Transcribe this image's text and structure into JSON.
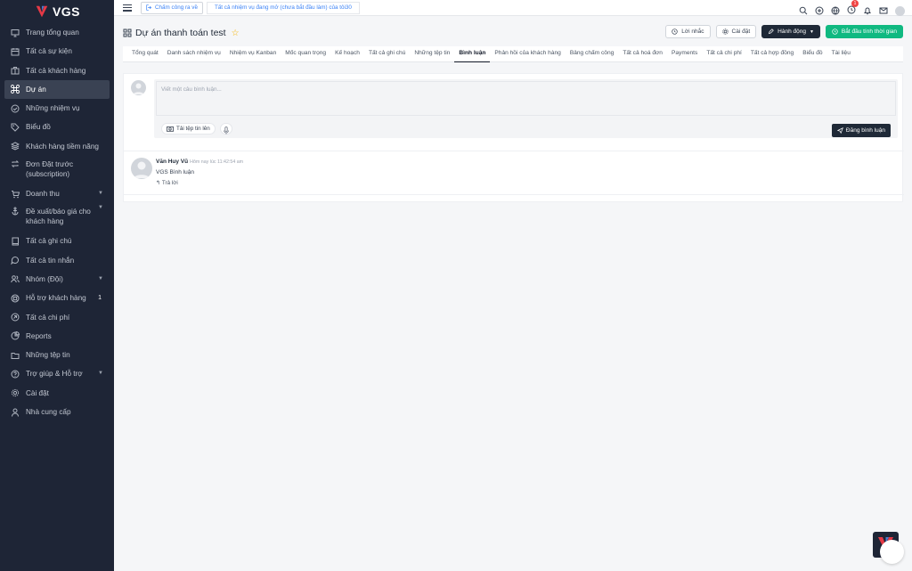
{
  "brand": {
    "name": "VGS",
    "accent": "#e63946"
  },
  "sidebar": {
    "items": [
      {
        "label": "Trang tổng quan",
        "icon": "monitor-icon"
      },
      {
        "label": "Tất cả sự kiện",
        "icon": "calendar-icon"
      },
      {
        "label": "Tất cả khách hàng",
        "icon": "briefcase-icon"
      },
      {
        "label": "Dự án",
        "icon": "command-icon",
        "active": true
      },
      {
        "label": "Những nhiệm vụ",
        "icon": "check-circle-icon"
      },
      {
        "label": "Biểu đồ",
        "icon": "tag-icon"
      },
      {
        "label": "Khách hàng tiềm năng",
        "icon": "layers-icon"
      },
      {
        "label": "Đơn Đặt trước (subscription)",
        "icon": "repeat-icon"
      },
      {
        "label": "Doanh thu",
        "icon": "cart-icon",
        "chevron": "▼"
      },
      {
        "label": "Đề xuất/báo giá cho khách hàng",
        "icon": "anchor-icon",
        "chevron": "▼"
      },
      {
        "label": "Tất cả ghi chú",
        "icon": "book-icon"
      },
      {
        "label": "Tất cả tin nhắn",
        "icon": "message-icon"
      },
      {
        "label": "Nhóm (Đội)",
        "icon": "users-icon",
        "chevron": "▼"
      },
      {
        "label": "Hỗ trợ khách hàng",
        "icon": "lifebuoy-icon",
        "count": "1"
      },
      {
        "label": "Tất cả chi phí",
        "icon": "arrow-circle-icon"
      },
      {
        "label": "Reports",
        "icon": "pie-chart-icon"
      },
      {
        "label": "Những tệp tin",
        "icon": "folder-icon"
      },
      {
        "label": "Trợ giúp & Hỗ trợ",
        "icon": "help-circle-icon",
        "chevron": "▼"
      },
      {
        "label": "Cài đặt",
        "icon": "settings-icon"
      },
      {
        "label": "Nhà cung cấp",
        "icon": "user-icon"
      }
    ]
  },
  "topbar": {
    "clockout": "Chấm công ra về",
    "tasks": "Tất cả nhiệm vụ đang mở (chưa bắt đầu làm) của tôi30",
    "notif_count": "1"
  },
  "header": {
    "title": "Dự án thanh toán test",
    "reminder": "Lời nhắc",
    "settings": "Cài đặt",
    "actions": "Hành động",
    "timer": "Bắt đầu tính thời gian"
  },
  "tabs": [
    "Tổng quát",
    "Danh sách nhiệm vụ",
    "Nhiệm vụ Kanban",
    "Mốc quan trọng",
    "Kế hoạch",
    "Tất cả ghi chú",
    "Những tệp tin",
    "Bình luận",
    "Phản hồi của khách hàng",
    "Bảng chấm công",
    "Tất cả hoá đơn",
    "Payments",
    "Tất cả chi phí",
    "Tất cả hợp đồng",
    "Biểu đồ",
    "Tài liệu"
  ],
  "active_tab": "Bình luận",
  "composer": {
    "placeholder": "Viết một câu bình luận...",
    "upload": "Tải tệp tin lên",
    "post": "Đăng bình luận"
  },
  "comments": [
    {
      "author": "Văn Huy Vũ",
      "time": "Hôm nay lúc 11:42:54 am",
      "text": "VGS Bình luận",
      "reply": "Trả lời"
    }
  ]
}
